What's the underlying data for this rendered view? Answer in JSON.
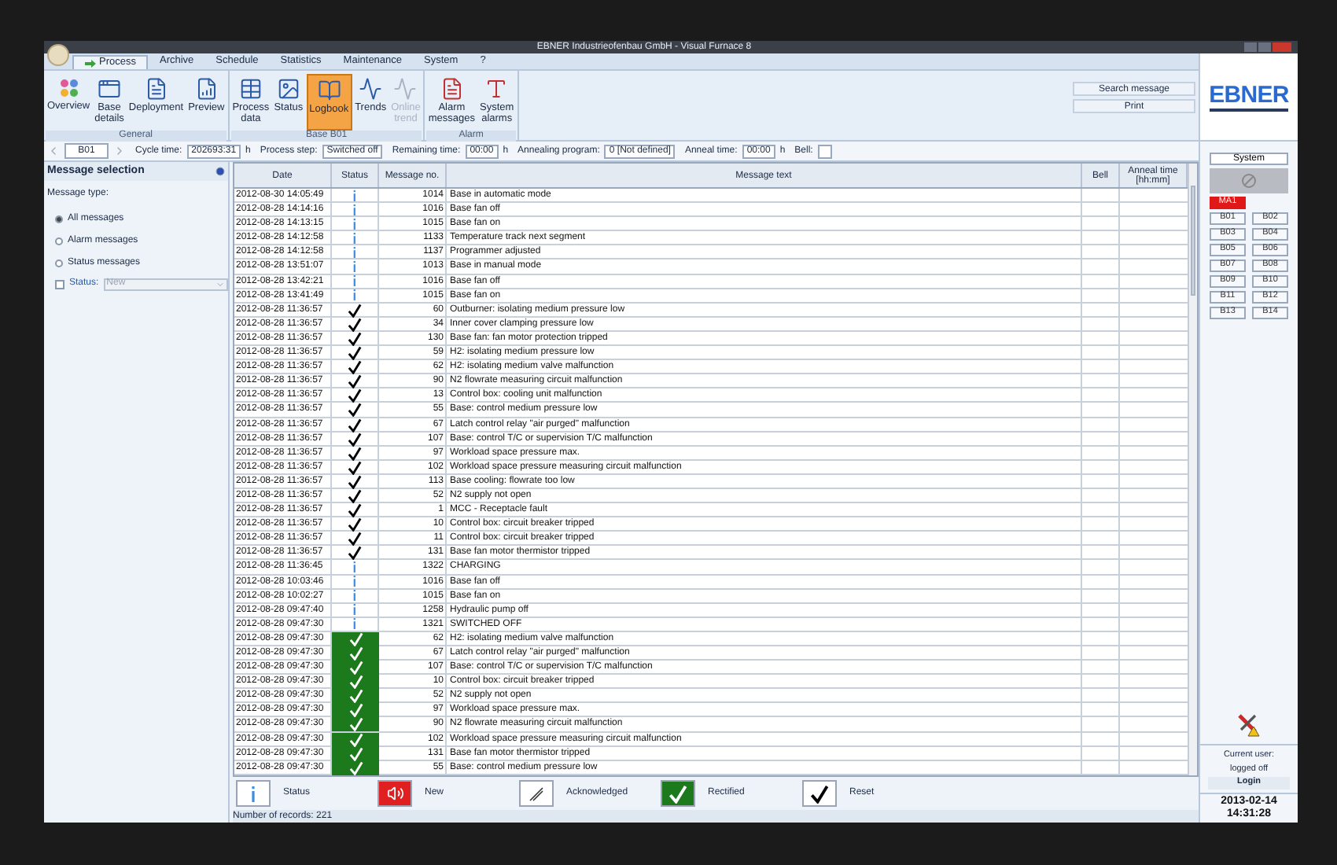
{
  "window": {
    "title": "EBNER Industrieofenbau GmbH - Visual Furnace 8"
  },
  "tabs": [
    {
      "label": "Process",
      "selected": true
    },
    {
      "label": "Archive",
      "selected": false
    },
    {
      "label": "Schedule",
      "selected": false
    },
    {
      "label": "Statistics",
      "selected": false
    },
    {
      "label": "Maintenance",
      "selected": false
    },
    {
      "label": "System",
      "selected": false
    },
    {
      "label": "?",
      "selected": false
    }
  ],
  "ribbon": {
    "groups": [
      {
        "label": "General",
        "items": [
          {
            "label": "Overview",
            "selected": false,
            "disabled": false
          },
          {
            "label": "Base details",
            "selected": false,
            "disabled": false
          },
          {
            "label": "Deployment",
            "selected": false,
            "disabled": false
          },
          {
            "label": "Preview",
            "selected": false,
            "disabled": false
          }
        ]
      },
      {
        "label": "Base B01",
        "items": [
          {
            "label": "Process data",
            "selected": false,
            "disabled": false
          },
          {
            "label": "Status",
            "selected": false,
            "disabled": false
          },
          {
            "label": "Logbook",
            "selected": true,
            "disabled": false
          },
          {
            "label": "Trends",
            "selected": false,
            "disabled": false
          },
          {
            "label": "Online trend",
            "selected": false,
            "disabled": true
          }
        ]
      },
      {
        "label": "Alarm",
        "items": [
          {
            "label": "Alarm messages",
            "selected": false,
            "disabled": false
          },
          {
            "label": "System alarms",
            "selected": false,
            "disabled": false
          }
        ]
      }
    ],
    "buttons": [
      "Search message",
      "Print"
    ]
  },
  "logo": "EBNER",
  "toolbar": {
    "base": "B01",
    "fields": [
      {
        "label": "Cycle time:",
        "value": "202693:31",
        "unit": "h"
      },
      {
        "label": "Process step:",
        "value": "Switched off"
      },
      {
        "label": "Remaining time:",
        "value": "00:00",
        "unit": "h"
      },
      {
        "label": "Annealing program:",
        "value": "0 [Not defined]"
      },
      {
        "label": "Anneal time:",
        "value": "00:00",
        "unit": "h"
      },
      {
        "label": "Bell:"
      }
    ]
  },
  "message_selection": {
    "title": "Message selection",
    "type_label": "Message type:",
    "options": [
      {
        "label": "All messages",
        "selected": true
      },
      {
        "label": "Alarm messages",
        "selected": false
      },
      {
        "label": "Status messages",
        "selected": false
      }
    ],
    "status_filter": {
      "label": "Status:",
      "checked": false,
      "value": "New"
    }
  },
  "table": {
    "columns": [
      "Date",
      "Status",
      "Message no.",
      "Message text",
      "Bell",
      "Anneal time [hh:mm]"
    ],
    "rows": [
      {
        "date": "2012-08-30 14:05:49",
        "kind": "info",
        "no": "1014",
        "text": "Base in automatic mode"
      },
      {
        "date": "2012-08-28 14:14:16",
        "kind": "info",
        "no": "1016",
        "text": "Base fan off"
      },
      {
        "date": "2012-08-28 14:13:15",
        "kind": "info",
        "no": "1015",
        "text": "Base fan on"
      },
      {
        "date": "2012-08-28 14:12:58",
        "kind": "info",
        "no": "1133",
        "text": "Temperature track next segment"
      },
      {
        "date": "2012-08-28 14:12:58",
        "kind": "info",
        "no": "1137",
        "text": "Programmer adjusted"
      },
      {
        "date": "2012-08-28 13:51:07",
        "kind": "info",
        "no": "1013",
        "text": "Base in manual mode"
      },
      {
        "date": "2012-08-28 13:42:21",
        "kind": "info",
        "no": "1016",
        "text": "Base fan off"
      },
      {
        "date": "2012-08-28 13:41:49",
        "kind": "info",
        "no": "1015",
        "text": "Base fan on"
      },
      {
        "date": "2012-08-28 11:36:57",
        "kind": "reset",
        "no": "60",
        "text": "Outburner: isolating medium pressure low"
      },
      {
        "date": "2012-08-28 11:36:57",
        "kind": "reset",
        "no": "34",
        "text": "Inner cover clamping pressure low"
      },
      {
        "date": "2012-08-28 11:36:57",
        "kind": "reset",
        "no": "130",
        "text": "Base fan: fan motor protection tripped"
      },
      {
        "date": "2012-08-28 11:36:57",
        "kind": "reset",
        "no": "59",
        "text": "H2: isolating medium pressure low"
      },
      {
        "date": "2012-08-28 11:36:57",
        "kind": "reset",
        "no": "62",
        "text": "H2: isolating medium valve malfunction"
      },
      {
        "date": "2012-08-28 11:36:57",
        "kind": "reset",
        "no": "90",
        "text": "N2 flowrate measuring circuit malfunction"
      },
      {
        "date": "2012-08-28 11:36:57",
        "kind": "reset",
        "no": "13",
        "text": "Control box: cooling unit malfunction"
      },
      {
        "date": "2012-08-28 11:36:57",
        "kind": "reset",
        "no": "55",
        "text": "Base: control medium pressure low"
      },
      {
        "date": "2012-08-28 11:36:57",
        "kind": "reset",
        "no": "67",
        "text": "Latch control relay \"air purged\" malfunction"
      },
      {
        "date": "2012-08-28 11:36:57",
        "kind": "reset",
        "no": "107",
        "text": "Base: control T/C or supervision T/C malfunction"
      },
      {
        "date": "2012-08-28 11:36:57",
        "kind": "reset",
        "no": "97",
        "text": "Workload space pressure max."
      },
      {
        "date": "2012-08-28 11:36:57",
        "kind": "reset",
        "no": "102",
        "text": "Workload space pressure measuring circuit malfunction"
      },
      {
        "date": "2012-08-28 11:36:57",
        "kind": "reset",
        "no": "113",
        "text": "Base cooling: flowrate too low"
      },
      {
        "date": "2012-08-28 11:36:57",
        "kind": "reset",
        "no": "52",
        "text": "N2 supply not open"
      },
      {
        "date": "2012-08-28 11:36:57",
        "kind": "reset",
        "no": "1",
        "text": "MCC - Receptacle fault"
      },
      {
        "date": "2012-08-28 11:36:57",
        "kind": "reset",
        "no": "10",
        "text": "Control box: circuit breaker tripped"
      },
      {
        "date": "2012-08-28 11:36:57",
        "kind": "reset",
        "no": "11",
        "text": "Control box: circuit breaker tripped"
      },
      {
        "date": "2012-08-28 11:36:57",
        "kind": "reset",
        "no": "131",
        "text": "Base fan motor thermistor tripped"
      },
      {
        "date": "2012-08-28 11:36:45",
        "kind": "info",
        "no": "1322",
        "text": "CHARGING"
      },
      {
        "date": "2012-08-28 10:03:46",
        "kind": "info",
        "no": "1016",
        "text": "Base fan off"
      },
      {
        "date": "2012-08-28 10:02:27",
        "kind": "info",
        "no": "1015",
        "text": "Base fan on"
      },
      {
        "date": "2012-08-28 09:47:40",
        "kind": "info",
        "no": "1258",
        "text": "Hydraulic pump off"
      },
      {
        "date": "2012-08-28 09:47:30",
        "kind": "info",
        "no": "1321",
        "text": "SWITCHED OFF"
      },
      {
        "date": "2012-08-28 09:47:30",
        "kind": "rectified",
        "no": "62",
        "text": "H2: isolating medium valve malfunction"
      },
      {
        "date": "2012-08-28 09:47:30",
        "kind": "rectified",
        "no": "67",
        "text": "Latch control relay \"air purged\" malfunction"
      },
      {
        "date": "2012-08-28 09:47:30",
        "kind": "rectified",
        "no": "107",
        "text": "Base: control T/C or supervision T/C malfunction"
      },
      {
        "date": "2012-08-28 09:47:30",
        "kind": "rectified",
        "no": "10",
        "text": "Control box: circuit breaker tripped"
      },
      {
        "date": "2012-08-28 09:47:30",
        "kind": "rectified",
        "no": "52",
        "text": "N2 supply not open"
      },
      {
        "date": "2012-08-28 09:47:30",
        "kind": "rectified",
        "no": "97",
        "text": "Workload space pressure max."
      },
      {
        "date": "2012-08-28 09:47:30",
        "kind": "rectified",
        "no": "90",
        "text": "N2 flowrate measuring circuit malfunction"
      },
      {
        "date": "2012-08-28 09:47:30",
        "kind": "rectified",
        "no": "102",
        "text": "Workload space pressure measuring circuit malfunction"
      },
      {
        "date": "2012-08-28 09:47:30",
        "kind": "rectified",
        "no": "131",
        "text": "Base fan motor thermistor tripped"
      },
      {
        "date": "2012-08-28 09:47:30",
        "kind": "rectified",
        "no": "55",
        "text": "Base: control medium pressure low"
      }
    ]
  },
  "legend": [
    {
      "kind": "info",
      "label": "Status"
    },
    {
      "kind": "new",
      "label": "New"
    },
    {
      "kind": "acknowledged",
      "label": "Acknowledged"
    },
    {
      "kind": "rectified",
      "label": "Rectified"
    },
    {
      "kind": "reset",
      "label": "Reset"
    }
  ],
  "status_bar": "Number of records: 221",
  "side": {
    "system_button": "System",
    "units": [
      {
        "label": "MA1",
        "alarm": true
      }
    ],
    "bases": [
      {
        "label": "B01",
        "alarm": false
      },
      {
        "label": "B02",
        "alarm": false
      },
      {
        "label": "B03",
        "alarm": false
      },
      {
        "label": "B04",
        "alarm": false
      },
      {
        "label": "B05",
        "alarm": false
      },
      {
        "label": "B06",
        "alarm": false
      },
      {
        "label": "B07",
        "alarm": false
      },
      {
        "label": "B08",
        "alarm": false
      },
      {
        "label": "B09",
        "alarm": false
      },
      {
        "label": "B10",
        "alarm": false
      },
      {
        "label": "B11",
        "alarm": false
      },
      {
        "label": "B12",
        "alarm": false
      },
      {
        "label": "B13",
        "alarm": false
      },
      {
        "label": "B14",
        "alarm": false
      }
    ],
    "user_label": "Current user:",
    "user": "logged off",
    "login": "Login",
    "date": "2013-02-14",
    "time": "14:31:28"
  }
}
